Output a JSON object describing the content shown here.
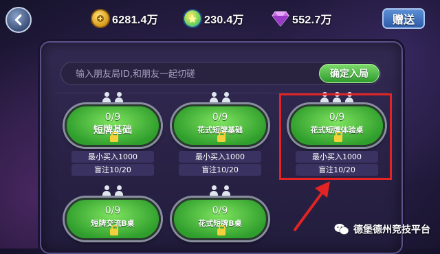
{
  "header": {
    "coins": "6281.4万",
    "chips": "230.4万",
    "diamonds": "552.7万",
    "gift_label": "赠送"
  },
  "search": {
    "placeholder": "输入朋友局ID,和朋友一起切磋",
    "confirm_label": "确定入局"
  },
  "tables": [
    {
      "count": "0/9",
      "name": "短牌基础",
      "min_buy": "最小买入1000",
      "blinds": "盲注10/20"
    },
    {
      "count": "0/9",
      "name": "花式短牌基础",
      "min_buy": "最小买入1000",
      "blinds": "盲注10/20"
    },
    {
      "count": "0/9",
      "name": "花式短牌体验桌",
      "min_buy": "最小买入1000",
      "blinds": "盲注10/20"
    },
    {
      "count": "0/9",
      "name": "短牌交流B桌"
    },
    {
      "count": "0/9",
      "name": "花式短牌B桌"
    }
  ],
  "watermark": "德堡德州竞技平台",
  "colors": {
    "highlight": "#e32424",
    "felt": "#4fc23f"
  }
}
